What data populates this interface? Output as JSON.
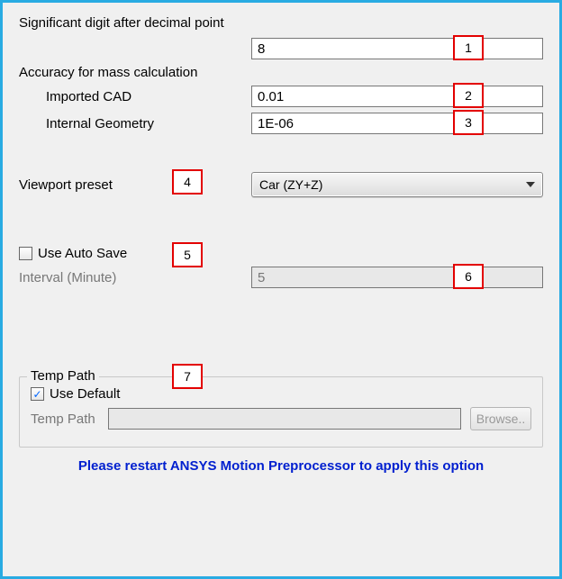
{
  "labels": {
    "sig_digit": "Significant digit after decimal point",
    "accuracy": "Accuracy for mass calculation",
    "imported_cad": "Imported CAD",
    "internal_geom": "Internal Geometry",
    "viewport_preset": "Viewport preset",
    "use_auto_save": "Use Auto Save",
    "interval": "Interval (Minute)",
    "temp_path_group": "Temp Path",
    "use_default": "Use Default",
    "temp_path": "Temp Path",
    "browse": "Browse..",
    "restart_msg": "Please restart ANSYS Motion Preprocessor to apply this option"
  },
  "values": {
    "sig_digit": "8",
    "imported_cad": "0.01",
    "internal_geom": "1E-06",
    "viewport_preset": "Car (ZY+Z)",
    "interval": "5",
    "temp_path": "",
    "auto_save_checked": false,
    "use_default_checked": true
  },
  "markers": {
    "m1": "1",
    "m2": "2",
    "m3": "3",
    "m4": "4",
    "m5": "5",
    "m6": "6",
    "m7": "7"
  }
}
